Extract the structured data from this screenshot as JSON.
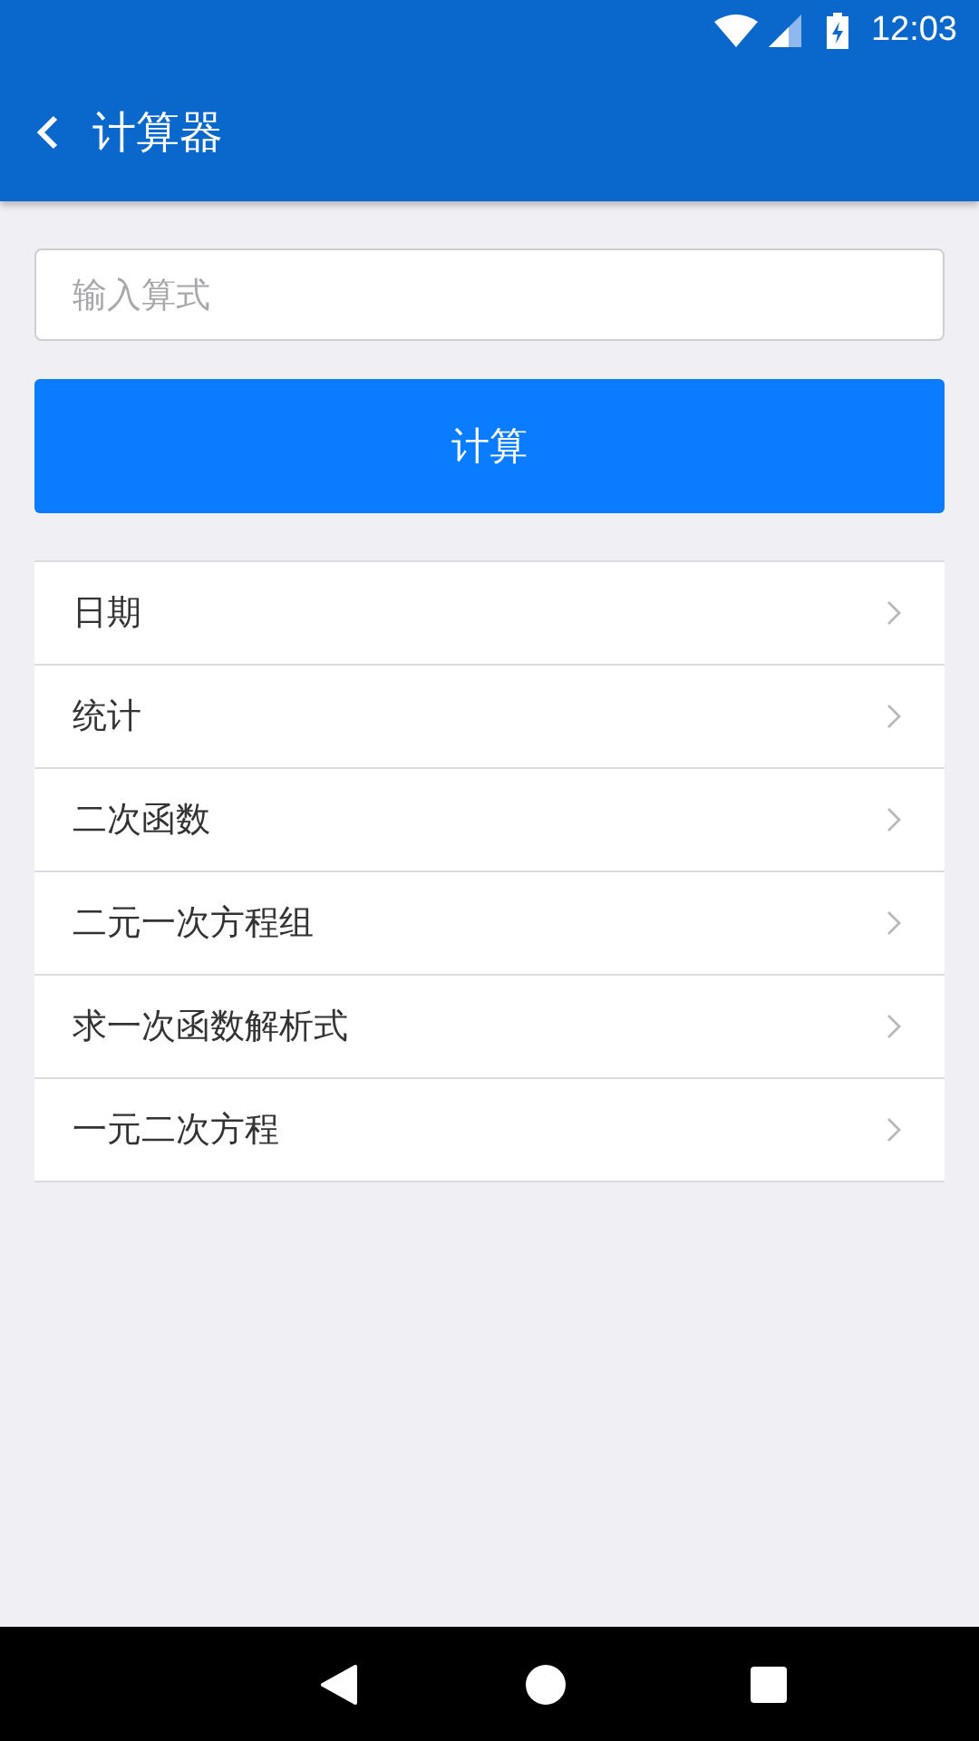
{
  "status_bar": {
    "time": "12:03"
  },
  "app_bar": {
    "title": "计算器"
  },
  "expression_field": {
    "placeholder": "输入算式"
  },
  "calculate_button": {
    "label": "计算"
  },
  "menu": [
    {
      "label": "日期"
    },
    {
      "label": "统计"
    },
    {
      "label": "二次函数"
    },
    {
      "label": "二元一次方程组"
    },
    {
      "label": "求一次函数解析式"
    },
    {
      "label": "一元二次方程"
    }
  ]
}
